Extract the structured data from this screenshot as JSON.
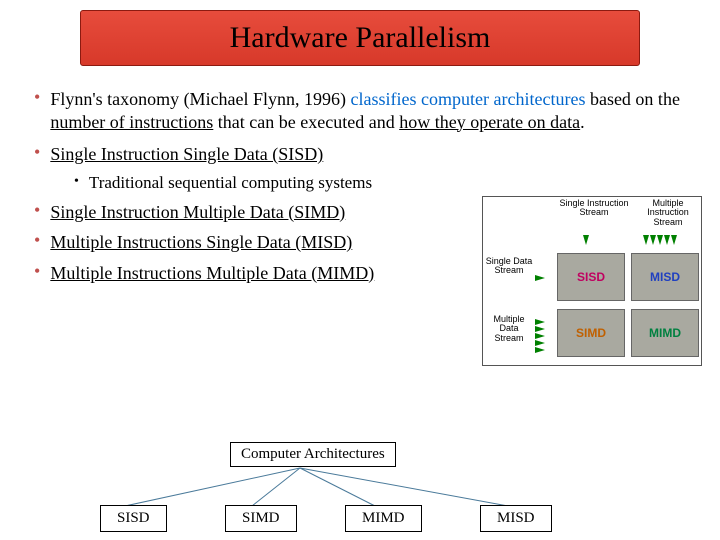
{
  "title": "Hardware Parallelism",
  "bullets": {
    "intro_pre": "Flynn's taxonomy (Michael Flynn, 1996) ",
    "intro_link": "classifies computer architectures",
    "intro_mid": " based on the ",
    "intro_u1": "number of instructions",
    "intro_mid2": " that can be executed and ",
    "intro_u2": "how they operate on data",
    "intro_end": ".",
    "sisd_pre": "Single Instruction ",
    "sisd_u": "S",
    "sisd_mid": "ingle ",
    "sisd_u2": "D",
    "sisd_end": "ata (SISD)",
    "sisd_label": "Single Instruction Single Data (SISD)",
    "sisd_sub": "Traditional sequential computing systems",
    "simd_label": "Single Instruction Multiple Data (SIMD)",
    "misd_label": "Multiple Instructions Single Data (MISD)",
    "mimd_label": "Multiple Instructions Multiple Data (MIMD)"
  },
  "figure": {
    "col1": "Single Instruction Stream",
    "col2": "Multiple Instruction Stream",
    "row1": "Single Data Stream",
    "row2": "Multiple Data Stream",
    "sisd": "SISD",
    "misd": "MISD",
    "simd": "SIMD",
    "mimd": "MIMD"
  },
  "tree": {
    "root": "Computer Architectures",
    "leaf1": "SISD",
    "leaf2": "SIMD",
    "leaf3": "MIMD",
    "leaf4": "MISD"
  }
}
